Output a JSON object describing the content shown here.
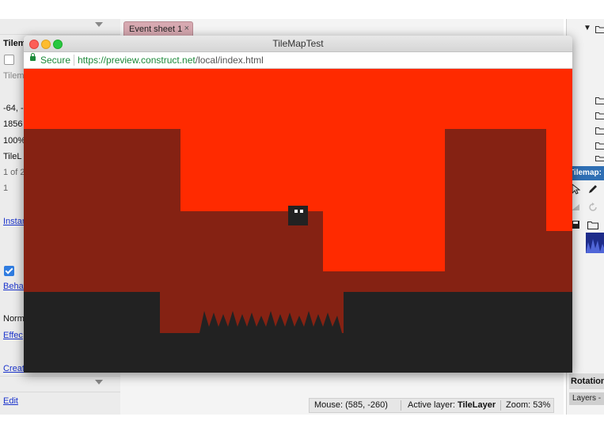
{
  "left_panel": {
    "rows": [
      "Tilem",
      "",
      "Tilem",
      "-64, -",
      "1856",
      "100%",
      "TileL",
      "1 of 2",
      "1"
    ],
    "links": [
      "Instan",
      "Behav",
      "Effec",
      "Creat",
      "Edit"
    ],
    "normal_label": "Norm"
  },
  "tab": {
    "label": "Event sheet 1",
    "close": "×"
  },
  "browser": {
    "title": "TileMapTest",
    "secure_label": "Secure",
    "url_scheme_host": "https://preview.construct.net",
    "url_path": "/local/index.html"
  },
  "right_panel": {
    "tilemap_header": "Tilemap:",
    "rotation_label": "Rotation",
    "layers_label": "Layers -"
  },
  "status": {
    "mouse": "Mouse: (585, -260)",
    "active_layer_label": "Active layer:",
    "active_layer_value": "TileLayer",
    "zoom": "Zoom: 53%"
  },
  "colors": {
    "sky_red": "#ff2a00",
    "wall_dark_red": "#852213",
    "ground_black": "#222222",
    "player": "#222222"
  },
  "icons": [
    "lock-icon",
    "folder-icon",
    "pointer-icon",
    "pencil-icon",
    "rotate-icon",
    "close-icon"
  ]
}
